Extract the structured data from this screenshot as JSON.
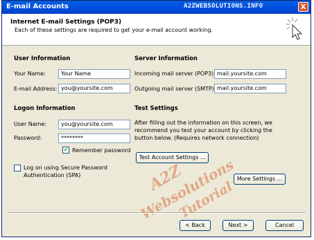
{
  "window": {
    "title": "E-mail Accounts",
    "watermark_top": "A2ZWEBSOLUTIONS.INFO",
    "close_label": "X"
  },
  "header": {
    "title": "Internet E-mail Settings (POP3)",
    "subtitle": "Each of these settings are required to get your e-mail account working."
  },
  "user_info": {
    "heading": "User Information",
    "name_label": "Your Name:",
    "name_value": "Your Name",
    "email_label": "E-mail Address:",
    "email_value": "you@yoursite.com"
  },
  "server_info": {
    "heading": "Server Information",
    "incoming_label": "Incoming mail server (POP3):",
    "incoming_value": "mail.yoursite.com",
    "outgoing_label": "Outgoing mail server (SMTP):",
    "outgoing_value": "mail.yoursite.com"
  },
  "logon_info": {
    "heading": "Logon Information",
    "user_label": "User Name:",
    "user_value": "you@yoursite.com",
    "password_label": "Password:",
    "password_value": "********",
    "remember_label": "Remember password",
    "remember_checked": true,
    "spa_label_line1": "Log on using Secure Password",
    "spa_label_line2": "Authentication (SPA)",
    "spa_checked": false
  },
  "test_settings": {
    "heading": "Test Settings",
    "desc_line1": "After filling out the information on this screen, we",
    "desc_line2": "recommend you test your account by clicking the",
    "desc_line3": "button below. (Requires network connection)",
    "test_button": "Test Account Settings ...",
    "more_button": "More Settings ..."
  },
  "watermark_overlay": {
    "line1": "A2Z",
    "line2": "Websolutions",
    "line3": "Tutorial"
  },
  "footer": {
    "back": "< Back",
    "next": "Next >",
    "cancel": "Cancel"
  }
}
